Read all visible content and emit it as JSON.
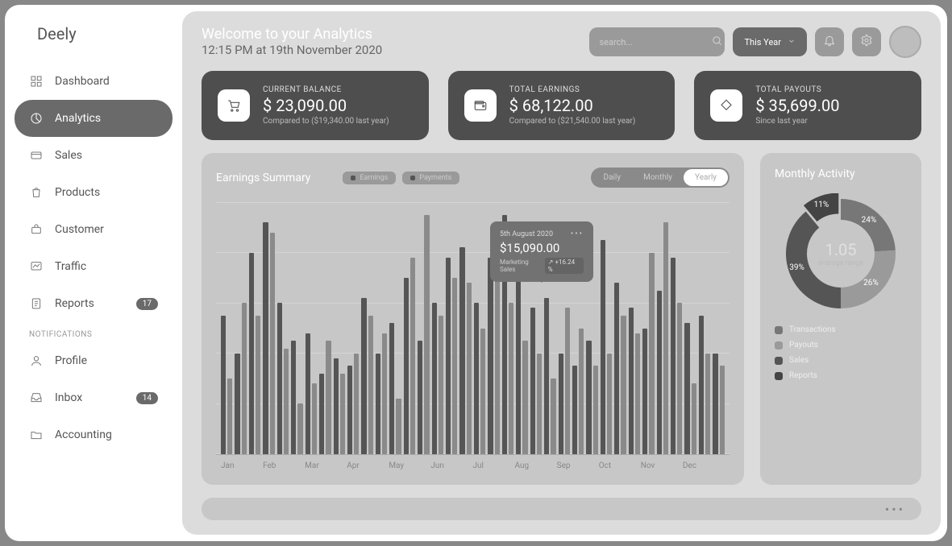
{
  "brand": "Deely",
  "nav": {
    "items": [
      {
        "icon": "grid",
        "label": "Dashboard"
      },
      {
        "icon": "pie",
        "label": "Analytics",
        "active": true
      },
      {
        "icon": "card",
        "label": "Sales"
      },
      {
        "icon": "bag",
        "label": "Products"
      },
      {
        "icon": "suitcase",
        "label": "Customer"
      },
      {
        "icon": "chart",
        "label": "Traffic"
      },
      {
        "icon": "doc",
        "label": "Reports",
        "badge": "17"
      }
    ],
    "section_label": "NOTIFICATIONS",
    "notif_items": [
      {
        "icon": "user",
        "label": "Profile"
      },
      {
        "icon": "inbox",
        "label": "Inbox",
        "badge": "14"
      },
      {
        "icon": "folder",
        "label": "Accounting"
      }
    ]
  },
  "header": {
    "title": "Welcome to your Analytics",
    "subtitle": "12:15 PM at 19th November 2020",
    "search_placeholder": "search...",
    "year_label": "This Year"
  },
  "stats": [
    {
      "label": "CURRENT BALANCE",
      "value": "$ 23,090.00",
      "compare": "Compared to ($19,340.00 last year)",
      "icon": "cart"
    },
    {
      "label": "TOTAL EARNINGS",
      "value": "$ 68,122.00",
      "compare": "Compared to ($21,540.00 last year)",
      "icon": "wallet"
    },
    {
      "label": "TOTAL PAYOUTS",
      "value": "$ 35,699.00",
      "compare": "Since last year",
      "icon": "diamond"
    }
  ],
  "earnings_panel": {
    "title": "Earnings Summary",
    "legend": [
      {
        "label": "Earnings",
        "color": "#555"
      },
      {
        "label": "Payments",
        "color": "#555"
      }
    ],
    "segments": [
      "Daily",
      "Monthly",
      "Yearly"
    ],
    "active_segment": 2,
    "tooltip": {
      "date": "5th August 2020",
      "value": "$15,090.00",
      "series_label": "Marketing Sales",
      "change": "+16.24 %"
    }
  },
  "activity_panel": {
    "title": "Monthly Activity",
    "center_value": "1.05",
    "center_label": "avarage range",
    "slices": [
      {
        "label": "Transactions",
        "value": 24,
        "color": "#777"
      },
      {
        "label": "Payouts",
        "value": 26,
        "color": "#9a9a9a"
      },
      {
        "label": "Sales",
        "value": 39,
        "color": "#555"
      },
      {
        "label": "Reports",
        "value": 11,
        "color": "#444"
      }
    ]
  },
  "chart_data": {
    "type": "bar",
    "title": "Earnings Summary",
    "xlabel": "",
    "ylabel": "",
    "ylim": [
      0,
      100
    ],
    "categories": [
      "Jan",
      "Feb",
      "Mar",
      "Apr",
      "May",
      "Jun",
      "Jul",
      "Aug",
      "Sep",
      "Oct",
      "Nov",
      "Dec"
    ],
    "series": [
      {
        "name": "Earnings",
        "values": [
          55,
          40,
          80,
          92,
          60,
          45,
          48,
          32,
          38,
          35,
          62,
          40,
          52,
          70,
          45,
          60,
          78,
          82,
          60,
          78,
          95,
          75,
          58,
          62,
          40,
          35,
          45,
          85,
          68,
          58,
          50,
          65,
          78,
          52,
          55,
          40
        ]
      },
      {
        "name": "Payments",
        "values": [
          30,
          60,
          55,
          88,
          42,
          20,
          28,
          45,
          32,
          40,
          55,
          48,
          22,
          78,
          95,
          55,
          70,
          68,
          50,
          88,
          60,
          45,
          40,
          30,
          58,
          50,
          35,
          40,
          55,
          48,
          80,
          92,
          60,
          28,
          40,
          35
        ]
      }
    ]
  }
}
